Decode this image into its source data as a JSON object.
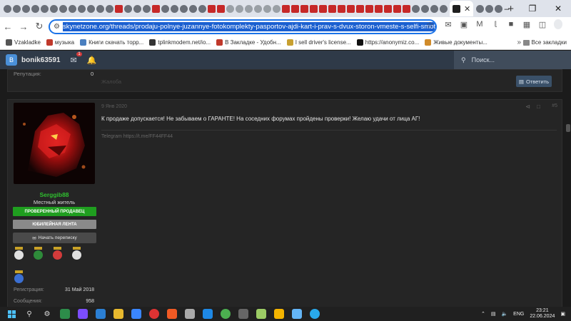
{
  "browser": {
    "active_tab_close": "✕",
    "new_tab": "+",
    "url": "skynetzone.org/threads/prodaju-polnye-juzannye-fotokomplekty-pasportov-ajdi-kart-i-prav-s-dvux-storon-vmeste-s-selfi-smotrite-video.",
    "window_controls": [
      "–",
      "❐",
      "✕"
    ],
    "bookmarks": [
      {
        "label": "Vzakladke",
        "color": "#555"
      },
      {
        "label": "музыка",
        "color": "#c0392b"
      },
      {
        "label": "Книги скачать торр...",
        "color": "#4a7fbf"
      },
      {
        "label": "tplinkmodem.net/io...",
        "color": "#333"
      },
      {
        "label": "В Закладке - Удобн...",
        "color": "#c0392b"
      },
      {
        "label": "I sell driver's license...",
        "color": "#c8a030"
      },
      {
        "label": "https://anonymiz.co...",
        "color": "#111"
      },
      {
        "label": "Живые документы...",
        "color": "#d08b2a"
      }
    ],
    "all_bookmarks": "Все закладки"
  },
  "forum": {
    "user_initial": "B",
    "username": "bonik63591",
    "notif_count": "1",
    "search_placeholder": "Поиск..."
  },
  "post1": {
    "reputation_label": "Репутация:",
    "reputation_value": "0",
    "complain": "Жалоба",
    "reply_label": "Ответить"
  },
  "post2": {
    "author": "Serggib88",
    "rank": "Местный житель",
    "banner_verified": "ПРОВЕРЕННЫЙ ПРОДАВЕЦ",
    "banner_jubilee": "ЮБИЛЕЙНАЯ ЛЕНТА",
    "message_button": "Начать переписку",
    "registration_label": "Регистрация:",
    "registration_value": "31 Май 2018",
    "messages_label": "Сообщения:",
    "messages_value": "958",
    "date": "9 Янв 2020",
    "post_number": "#5",
    "message": "К продаже допускается! Не забываем о ГАРАНТЕ! На соседних форумах пройдены проверки! Желаю удачи от лица АГ!",
    "signature": "Telegram https://t.me/FF44FF44",
    "medal_colors": [
      "#e0e0e0",
      "#2e8b3a",
      "#d23b3b",
      "#e0e0e0",
      "#3b6fd2"
    ]
  },
  "taskbar": {
    "lang": "ENG",
    "time": "23:21",
    "date": "22.06.2024"
  },
  "colors": {
    "accent": "#1a73e8",
    "forum_header": "#2f3a48",
    "verified": "#1f9e1f",
    "author": "#2fbf2f"
  }
}
